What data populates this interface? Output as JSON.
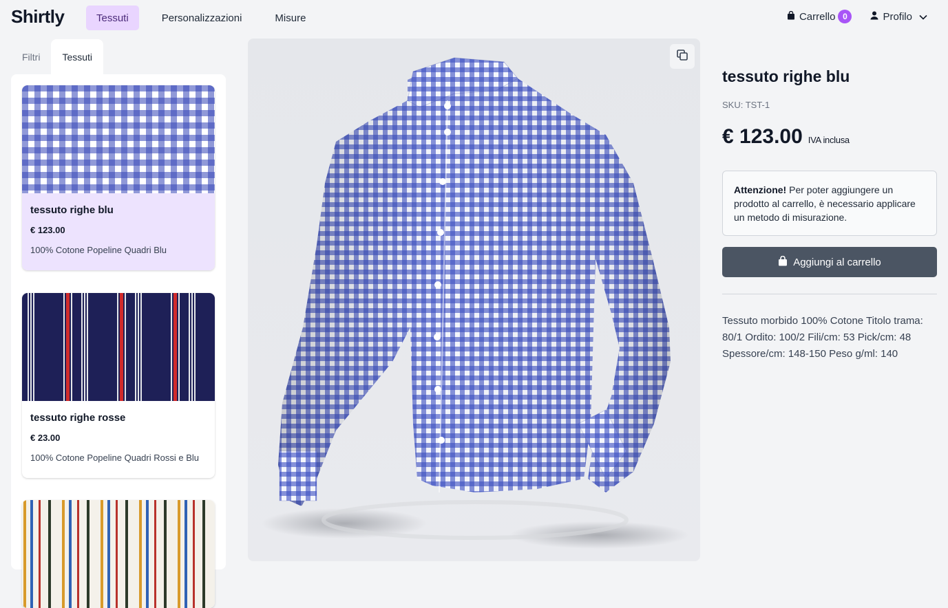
{
  "app": {
    "logo": "Shirtly"
  },
  "nav": {
    "items": [
      {
        "label": "Tessuti",
        "active": true
      },
      {
        "label": "Personalizzazioni",
        "active": false
      },
      {
        "label": "Misure",
        "active": false
      }
    ]
  },
  "header": {
    "cart_label": "Carrello",
    "cart_count": "0",
    "profile_label": "Profilo"
  },
  "sidebar": {
    "tabs": [
      {
        "label": "Filtri",
        "active": false
      },
      {
        "label": "Tessuti",
        "active": true
      }
    ],
    "fabrics": [
      {
        "name": "tessuto righe blu",
        "price": "€ 123.00",
        "description": "100% Cotone Popeline Quadri Blu",
        "selected": true,
        "pattern": "blue-gingham"
      },
      {
        "name": "tessuto righe rosse",
        "price": "€ 23.00",
        "description": "100% Cotone Popeline Quadri Rossi e Blu",
        "selected": false,
        "pattern": "navy-red-stripes"
      },
      {
        "pattern": "multicolor-stripes",
        "selected": false
      }
    ]
  },
  "viewer": {
    "toggle_icon": "copy-squares-icon"
  },
  "product": {
    "title": "tessuto righe blu",
    "sku": "SKU: TST-1",
    "price": "€ 123.00",
    "vat_note": "IVA inclusa",
    "alert_strong": "Attenzione!",
    "alert_text": " Per poter aggiungere un prodotto al carrello, è necessario applicare un metodo di misurazione.",
    "add_to_cart_label": "Aggiungi al carrello",
    "description": "Tessuto morbido 100% Cotone Titolo trama: 80/1 Ordito: 100/2 Fili/cm: 53 Pick/cm: 48 Spessore/cm: 148-150 Peso g/ml: 140"
  },
  "colors": {
    "accent_purple": "#a855f7",
    "nav_active_bg": "#e9d5ff",
    "selected_card_bg": "#ede3fe",
    "button_bg": "#4b5563",
    "gingham_blue": "#3545b8"
  }
}
